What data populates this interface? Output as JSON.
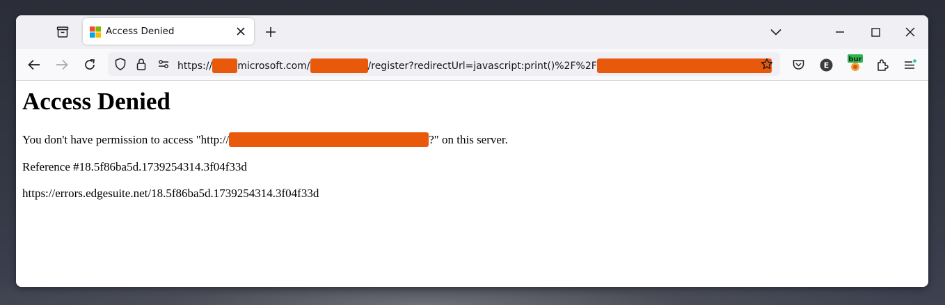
{
  "tab": {
    "title": "Access Denied",
    "favicon": "microsoft-logo"
  },
  "url": {
    "scheme": "https://",
    "domain_part": "microsoft.com/",
    "path_part": "/register?redirectUrl=javascript:print()%2F%2F"
  },
  "extension_badge": "bur",
  "page": {
    "heading": "Access Denied",
    "permission_prefix": "You don't have permission to access \"http://",
    "permission_suffix": "?\" on this server.",
    "reference": "Reference #18.5f86ba5d.1739254314.3f04f33d",
    "error_url": "https://errors.edgesuite.net/18.5f86ba5d.1739254314.3f04f33d"
  },
  "colors": {
    "redaction": "#e8590c",
    "tab_bar": "#f0f0f4",
    "nav_bar": "#f9f9fb"
  }
}
